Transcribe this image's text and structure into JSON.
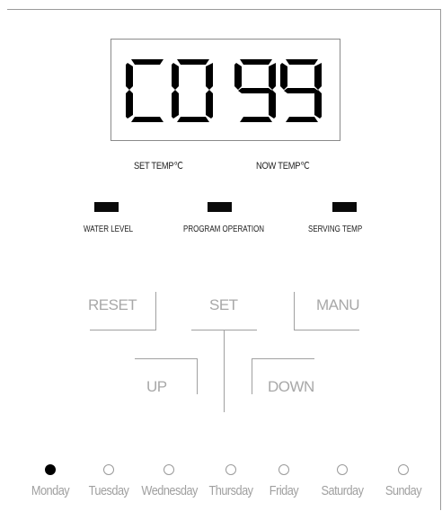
{
  "display": {
    "text": "C0 99",
    "label_set_temp": "SET TEMP℃",
    "label_now_temp": "NOW TEMP℃"
  },
  "indicators": [
    {
      "id": "water-level",
      "label": "WATER LEVEL"
    },
    {
      "id": "program-operation",
      "label": "PROGRAM OPERATION"
    },
    {
      "id": "serving-temp",
      "label": "SERVING TEMP"
    }
  ],
  "buttons": {
    "reset": "RESET",
    "set": "SET",
    "manu": "MANU",
    "up": "UP",
    "down": "DOWN"
  },
  "days": [
    {
      "label": "Monday",
      "selected": true
    },
    {
      "label": "Tuesday",
      "selected": false
    },
    {
      "label": "Wednesday",
      "selected": false
    },
    {
      "label": "Thursday",
      "selected": false
    },
    {
      "label": "Friday",
      "selected": false
    },
    {
      "label": "Saturday",
      "selected": false
    },
    {
      "label": "Sunday",
      "selected": false
    }
  ],
  "colors": {
    "segment": "#000000",
    "button_text": "#a8a8a8",
    "day_text": "#a0a0a0"
  }
}
